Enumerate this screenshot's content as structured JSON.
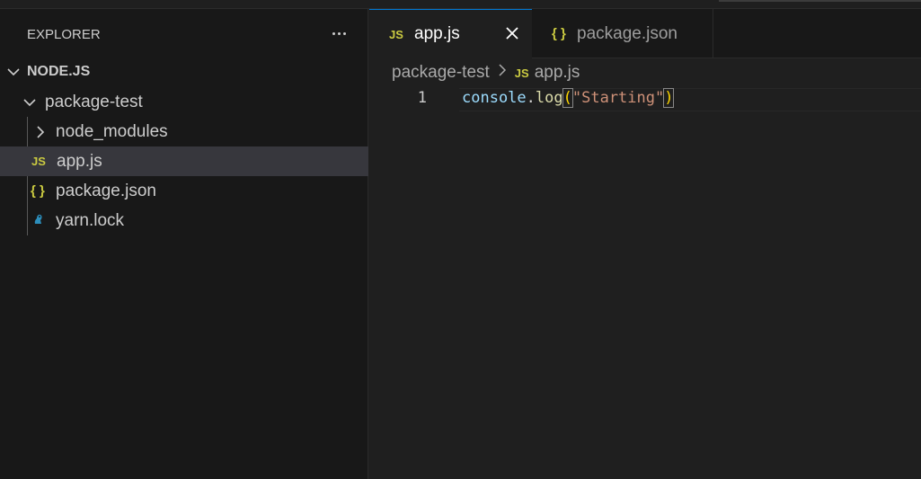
{
  "explorer": {
    "title": "EXPLORER",
    "more_icon": "ellipsis-icon",
    "tree": {
      "root_label": "NODE.JS",
      "folder_label": "package-test",
      "items": [
        {
          "label": "node_modules",
          "icon": "chevron-right-icon"
        },
        {
          "label": "app.js",
          "icon": "js-file-icon",
          "icon_text": "JS",
          "active": true
        },
        {
          "label": "package.json",
          "icon": "json-file-icon",
          "icon_text": "{ }"
        },
        {
          "label": "yarn.lock",
          "icon": "yarn-icon"
        }
      ]
    }
  },
  "tabs": [
    {
      "label": "app.js",
      "icon_text": "JS",
      "active": true
    },
    {
      "label": "package.json",
      "icon_text": "{ }",
      "active": false
    }
  ],
  "breadcrumb": {
    "folder": "package-test",
    "file_icon_text": "JS",
    "file": "app.js"
  },
  "editor": {
    "line_number": "1",
    "tokens": {
      "object": "console",
      "dot": ".",
      "method": "log",
      "open_paren": "(",
      "string": "\"Starting\"",
      "close_paren": ")"
    }
  },
  "colors": {
    "accent": "#0078d4",
    "js_icon": "#cbcb41",
    "yarn_icon": "#2c8ebb"
  }
}
